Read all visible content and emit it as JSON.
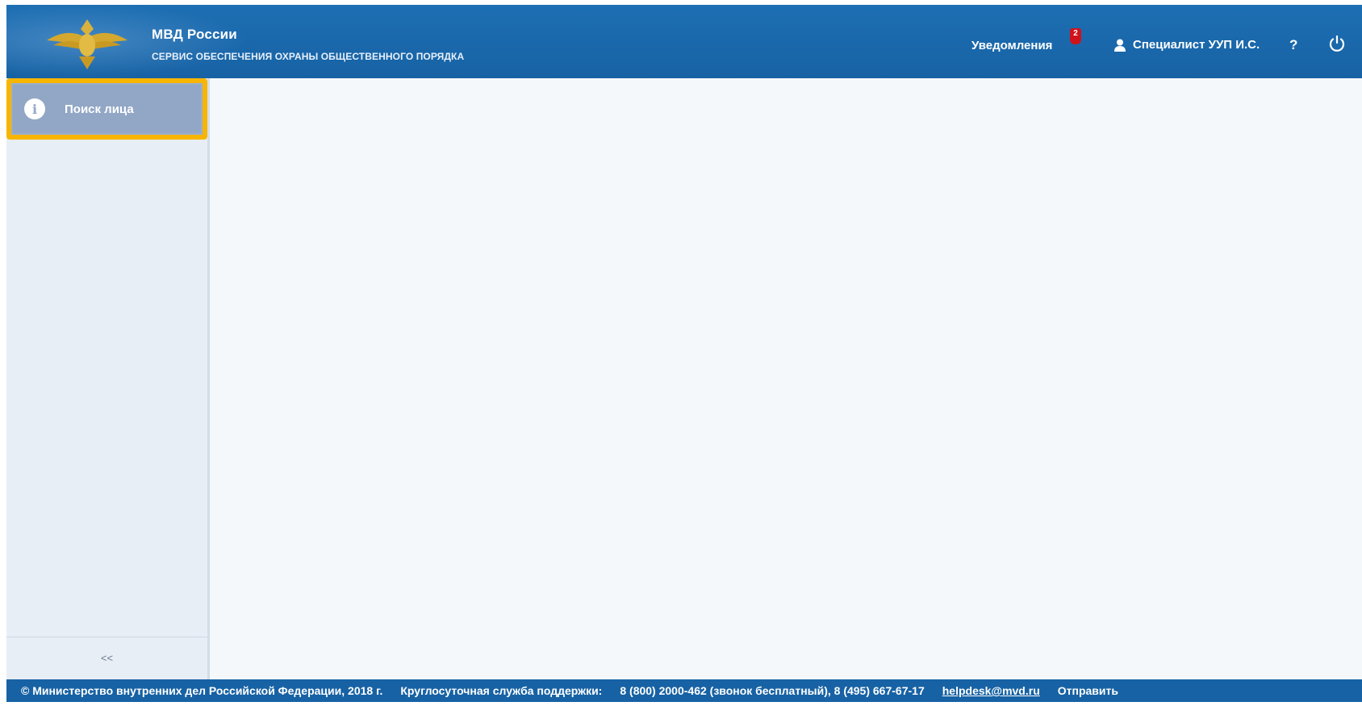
{
  "header": {
    "title": "МВД России",
    "subtitle": "СЕРВИС ОБЕСПЕЧЕНИЯ ОХРАНЫ ОБЩЕСТВЕННОГО ПОРЯДКА",
    "notifications_label": "Уведомления",
    "notifications_count": "2",
    "user_name": "Специалист УУП И.С.",
    "help_label": "?",
    "icons": [
      "emblem-icon",
      "user-icon",
      "power-icon"
    ]
  },
  "sidebar": {
    "items": [
      {
        "label": "Поиск лица",
        "icon": "info-icon",
        "active": true
      }
    ],
    "collapse_label": "<<"
  },
  "footer": {
    "copyright": "© Министерство внутренних дел Российской Федерации, 2018 г.",
    "support_label": "Круглосуточная служба поддержки:",
    "phones": "8 (800) 2000-462 (звонок бесплатный), 8 (495) 667-67-17",
    "email": "helpdesk@mvd.ru",
    "send_label": "Отправить"
  },
  "colors": {
    "header_bg": "#1762a4",
    "sidebar_bg": "#e8eef5",
    "active_item_bg": "#92a7c6",
    "highlight_border": "#f7b500",
    "badge": "#d0121b"
  }
}
